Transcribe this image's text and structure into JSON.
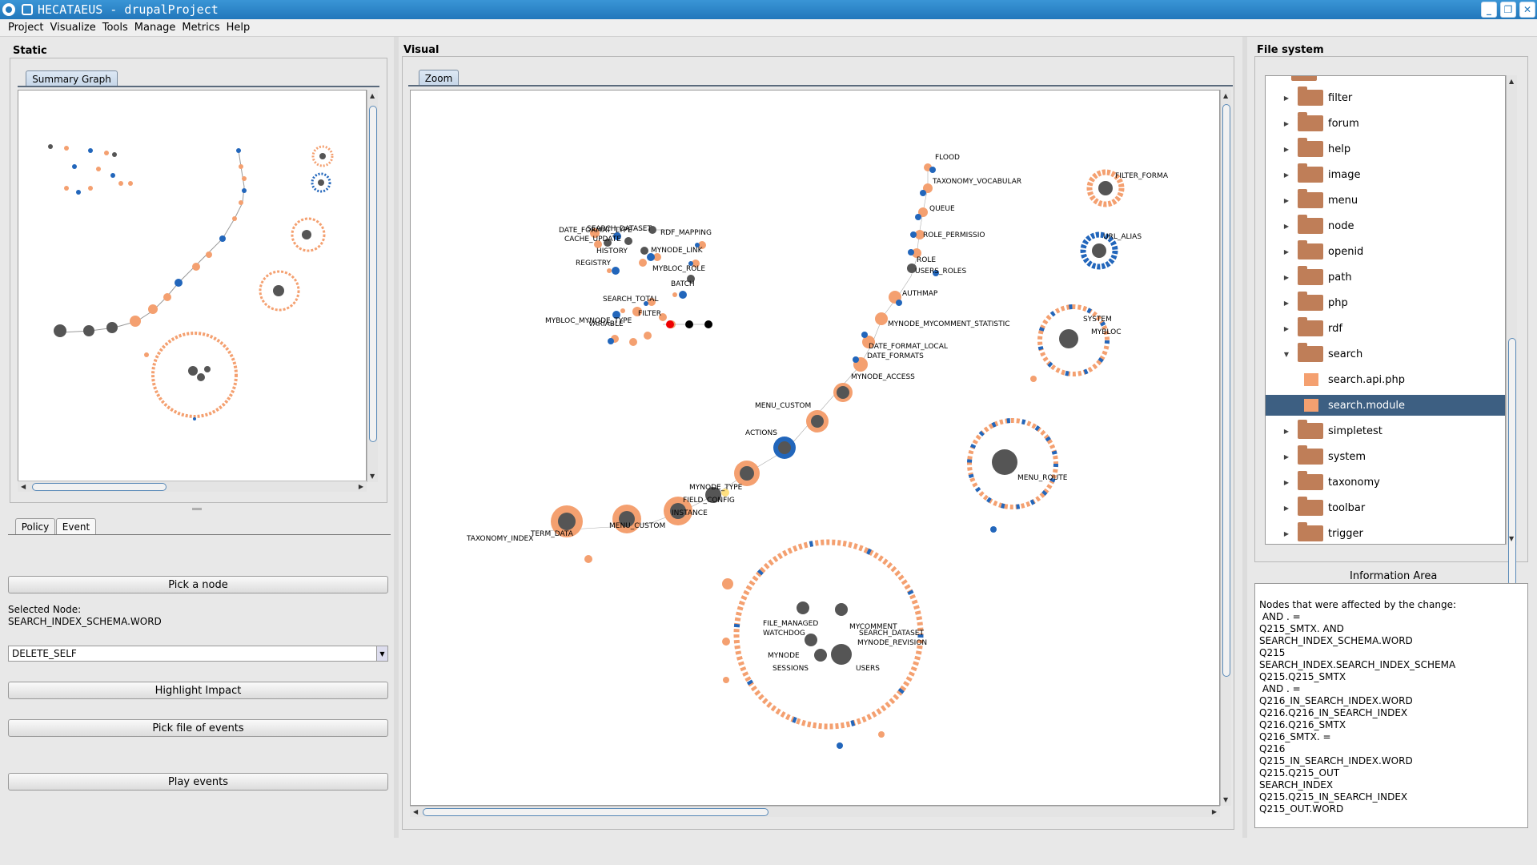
{
  "window": {
    "title": "HECATAEUS - drupalProject",
    "controls": [
      "_",
      "❐",
      "✕"
    ]
  },
  "menu": [
    "Project",
    "Visualize",
    "Tools",
    "Manage",
    "Metrics",
    "Help"
  ],
  "static_panel": {
    "title": "Static",
    "tab": "Summary Graph"
  },
  "event_panel": {
    "tabs": [
      "Policy",
      "Event"
    ],
    "pick_node": "Pick a node",
    "selected_label": "Selected Node:",
    "selected_value": "SEARCH_INDEX_SCHEMA.WORD",
    "event_type": "DELETE_SELF",
    "highlight": "Highlight Impact",
    "pick_file": "Pick file of events",
    "play": "Play events"
  },
  "visual_panel": {
    "title": "Visual",
    "tab": "Zoom"
  },
  "graph_labels": {
    "l1": "DATE_FORMAT_TYPE",
    "l2": "SEARCH_DATASET",
    "l3": "CACHE_UPDATE",
    "l4": "RDF_MAPPING",
    "l5": "HISTORY",
    "l6": "MYNODE_LINK",
    "l7": "REGISTRY",
    "l8": "MYBLOC_ROLE",
    "l9": "BATCH",
    "l10": "SEARCH_TOTAL",
    "l11": "FILTER",
    "l12": "MYBLOC_MYNODE_TYPE",
    "l13": "VARIABLE",
    "f1": "FLOOD",
    "f2": "TAXONOMY_VOCABULAR",
    "f3": "QUEUE",
    "f4": "ROLE_PERMISSIO",
    "f5": "ROLE",
    "f6": "USERS_ROLES",
    "f7": "AUTHMAP",
    "f8": "MYNODE_MYCOMMENT_STATISTIC",
    "f9": "DATE_FORMAT_LOCAL",
    "f10": "DATE_FORMATS",
    "f11": "MYNODE_ACCESS",
    "f12": "MENU_CUSTOM",
    "f13": "ACTIONS",
    "f14": "MYNODE_TYPE",
    "f15": "FIELD_CONFIG",
    "f16": "INSTANCE",
    "f17": "MENU_CUSTOM",
    "f18": "TAXONOMY_INDEX",
    "f19": "TERM_DATA",
    "r1": "FILTER_FORMA",
    "r2": "URL_ALIAS",
    "r3": "SYSTEM",
    "r4": "MYBLOC",
    "r5": "MENU_ROUTE",
    "c1": "FILE_MANAGED",
    "c2": "WATCHDOG",
    "c3": "MYCOMMENT",
    "c4": "SEARCH_DATASET",
    "c5": "MYNODE_REVISION",
    "c6": "MYNODE",
    "c7": "SESSIONS",
    "c8": "USERS"
  },
  "file_system": {
    "title": "File system",
    "items": [
      {
        "name": "filter",
        "type": "folder",
        "expanded": false
      },
      {
        "name": "forum",
        "type": "folder",
        "expanded": false
      },
      {
        "name": "help",
        "type": "folder",
        "expanded": false
      },
      {
        "name": "image",
        "type": "folder",
        "expanded": false
      },
      {
        "name": "menu",
        "type": "folder",
        "expanded": false
      },
      {
        "name": "node",
        "type": "folder",
        "expanded": false
      },
      {
        "name": "openid",
        "type": "folder",
        "expanded": false
      },
      {
        "name": "path",
        "type": "folder",
        "expanded": false
      },
      {
        "name": "php",
        "type": "folder",
        "expanded": false
      },
      {
        "name": "rdf",
        "type": "folder",
        "expanded": false
      },
      {
        "name": "search",
        "type": "folder",
        "expanded": true
      },
      {
        "name": "search.api.php",
        "type": "file"
      },
      {
        "name": "search.module",
        "type": "file",
        "selected": true
      },
      {
        "name": "simpletest",
        "type": "folder",
        "expanded": false
      },
      {
        "name": "system",
        "type": "folder",
        "expanded": false
      },
      {
        "name": "taxonomy",
        "type": "folder",
        "expanded": false
      },
      {
        "name": "toolbar",
        "type": "folder",
        "expanded": false
      },
      {
        "name": "trigger",
        "type": "folder",
        "expanded": false
      }
    ]
  },
  "info_area": {
    "title": "Information Area",
    "lines": [
      "Nodes that were affected by the change:",
      " AND . =",
      "Q215_SMTX. AND",
      "SEARCH_INDEX_SCHEMA.WORD",
      "Q215",
      "SEARCH_INDEX.SEARCH_INDEX_SCHEMA",
      "Q215.Q215_SMTX",
      " AND . =",
      "Q216_IN_SEARCH_INDEX.WORD",
      "Q216.Q216_IN_SEARCH_INDEX",
      "Q216.Q216_SMTX",
      "Q216_SMTX. =",
      "Q216",
      "Q215_IN_SEARCH_INDEX.WORD",
      "Q215.Q215_OUT",
      "SEARCH_INDEX",
      "Q215.Q215_IN_SEARCH_INDEX",
      "Q215_OUT.WORD"
    ]
  },
  "colors": {
    "orange_node": "#f4a070",
    "blue_node": "#2266bb",
    "gray_node": "#555555",
    "selected_row": "#3d5f82",
    "title_bar": "#2a80c4"
  }
}
